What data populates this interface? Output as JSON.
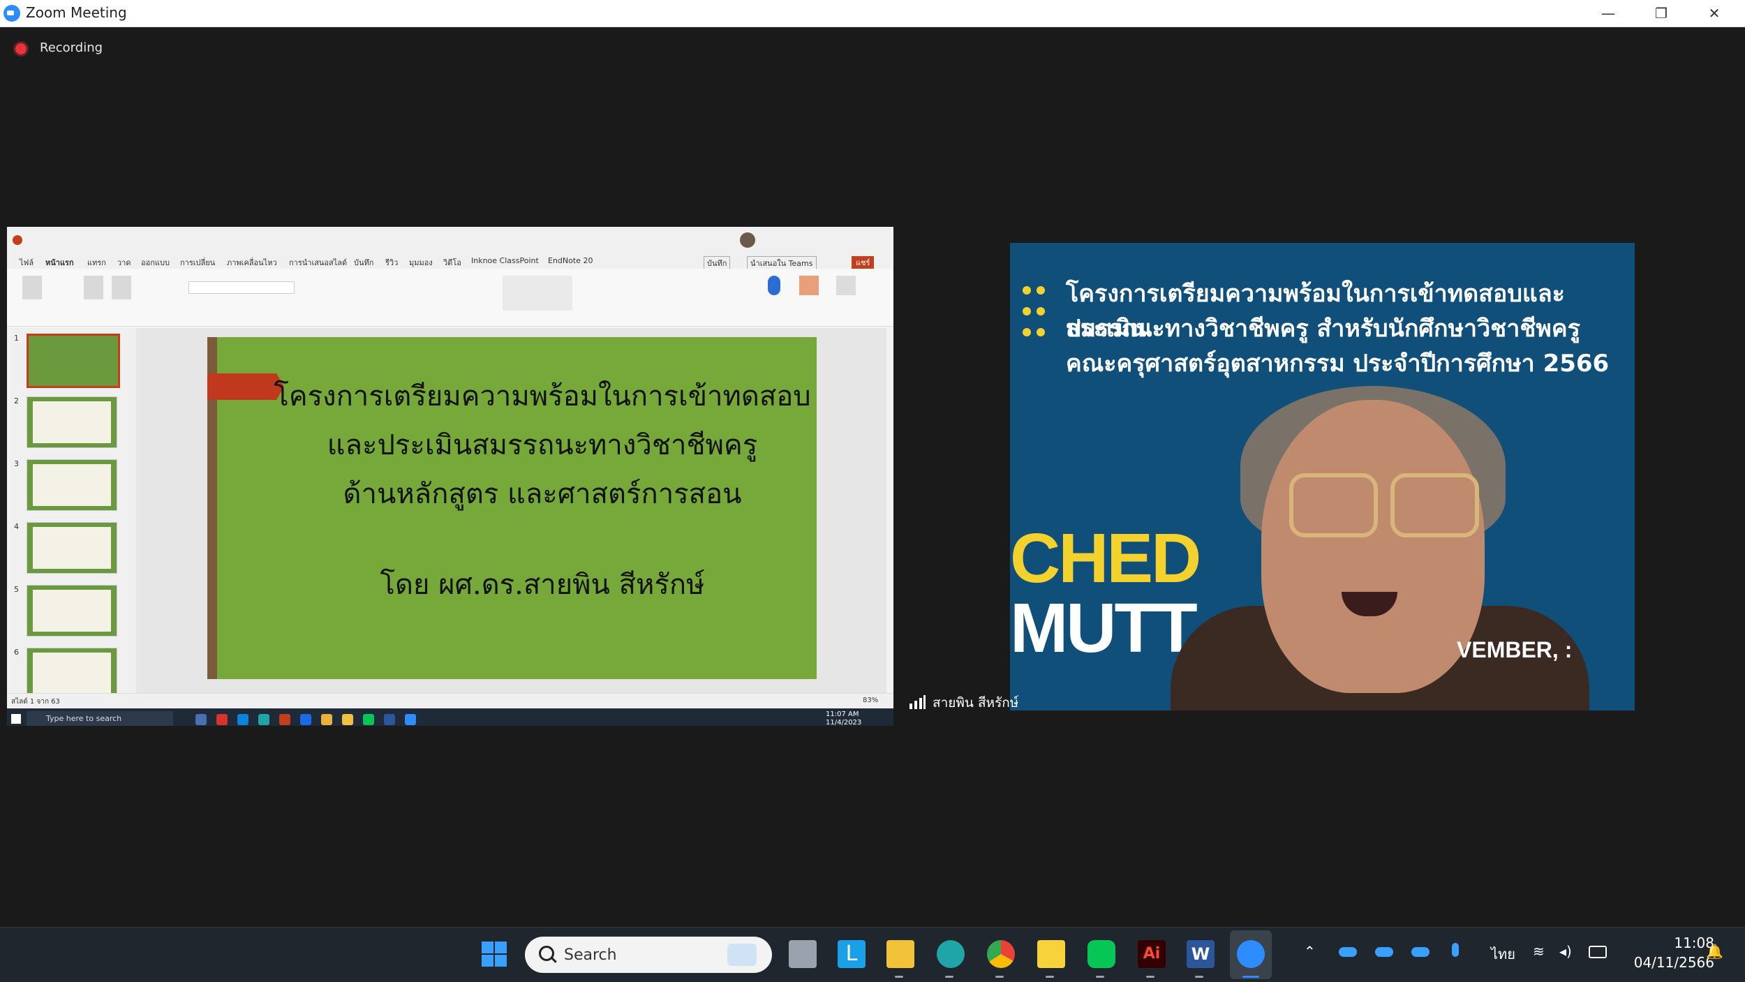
{
  "window": {
    "title": "Zoom Meeting",
    "minimize": "—",
    "restore": "❐",
    "close": "✕"
  },
  "recording": {
    "label": "Recording"
  },
  "shared_screen": {
    "ppt_tabs": [
      "ไฟล์",
      "หน้าแรก",
      "แทรก",
      "วาด",
      "ออกแบบ",
      "การเปลี่ยน",
      "ภาพเคลื่อนไหว",
      "การนำเสนอสไลด์",
      "บันทึก",
      "รีวิว",
      "มุมมอง",
      "วิดีโอ",
      "Inknoe ClassPoint",
      "EndNote 20"
    ],
    "ppt_ribbon": {
      "record_button": "บันทึก",
      "share_button": "แชร์",
      "teams_button": "นำเสนอใน Teams"
    },
    "thumbnails": [
      "1",
      "2",
      "3",
      "4",
      "5",
      "6"
    ],
    "slide": {
      "title_lines": [
        "โครงการเตรียมความพร้อมในการเข้าทดสอบ",
        "และประเมินสมรรถนะทางวิชาชีพครู",
        "ด้านหลักสูตร และศาสตร์การสอน"
      ],
      "author": "โดย ผศ.ดร.สายพิน สีหรักษ์"
    },
    "status_left": "สไลด์ 1 จาก 63",
    "status_zoom": "83%",
    "inner_taskbar": {
      "search_placeholder": "Type here to search",
      "time": "11:07 AM",
      "date": "11/4/2023"
    }
  },
  "video": {
    "banner_lines": [
      "โครงการเตรียมความพร้อมในการเข้าทดสอบและประเมิน",
      "สมรรถนะทางวิชาชีพครู สำหรับนักศึกษาวิชาชีพครู",
      "คณะครุศาสตร์อุตสาหกรรม ประจำปีการศึกษา 2566"
    ],
    "bg_text_1": "CHED",
    "bg_text_2": "MUTT",
    "bg_text_3": "VEMBER, :",
    "participant_name": "สายพิน สีหรักษ์"
  },
  "taskbar": {
    "search_label": "Search",
    "tray_lang": "ไทย",
    "time": "11:08",
    "date": "04/11/2566"
  },
  "colors": {
    "zoom_blue": "#2d8cff",
    "slide_green": "#76a93a",
    "video_bg": "#0f4f7a",
    "banner_yellow": "#f4d22e"
  }
}
